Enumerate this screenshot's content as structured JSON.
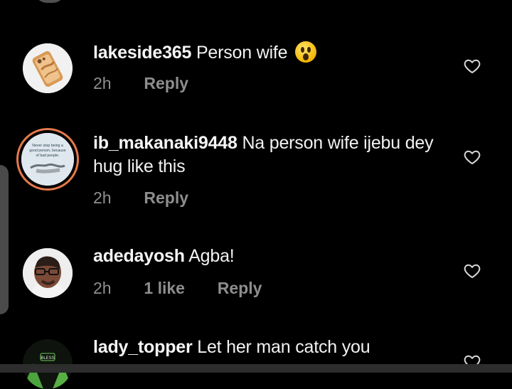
{
  "colors": {
    "background": "#000000",
    "username": "#f5f5f5",
    "meta": "#8e8e8e",
    "story_ring": "#e57a4a"
  },
  "comments": [
    {
      "username": "lakeside365",
      "text": "Person wife",
      "emoji": "astonished-face",
      "time": "2h",
      "likes": "",
      "reply": "Reply",
      "avatar": "phone-case-avatar",
      "liked": false
    },
    {
      "username": "ib_makanaki9448",
      "text": "Na person wife ijebu dey hug like this",
      "time": "2h",
      "likes": "",
      "reply": "Reply",
      "avatar": "quote-poster-avatar",
      "avatar_caption": "Never stop being a good person, because of bad people.",
      "story": true,
      "liked": false
    },
    {
      "username": "adedayosh",
      "text": "Agba!",
      "time": "2h",
      "likes": "1 like",
      "reply": "Reply",
      "avatar": "portrait-avatar",
      "liked": false
    },
    {
      "username": "lady_topper",
      "text": "Let her man catch you",
      "time": "",
      "likes": "",
      "reply": "",
      "avatar": "green-logo-avatar",
      "avatar_caption": "BLESS",
      "liked": false
    }
  ],
  "icons": {
    "heart": "heart-outline-icon",
    "emoji": "astonished-face"
  }
}
